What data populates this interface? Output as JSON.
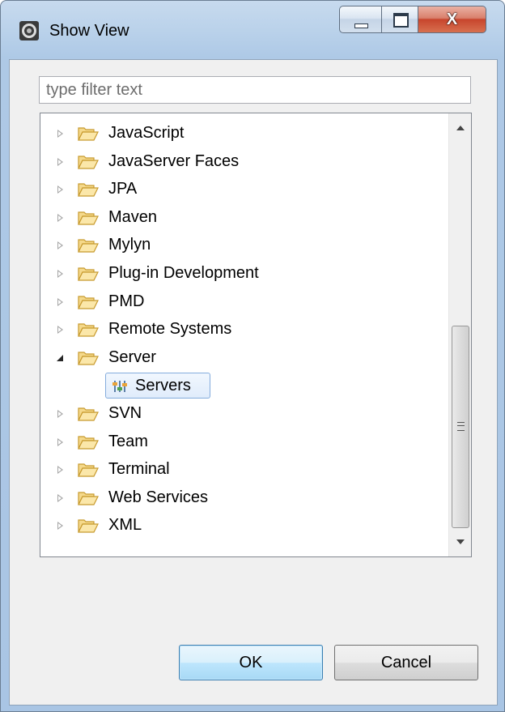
{
  "window": {
    "title": "Show View",
    "icon": "eclipse-icon",
    "close_glyph": "X"
  },
  "filter": {
    "placeholder": "type filter text",
    "value": ""
  },
  "tree": {
    "items": [
      {
        "label": "JavaScript",
        "expanded": false
      },
      {
        "label": "JavaServer Faces",
        "expanded": false
      },
      {
        "label": "JPA",
        "expanded": false
      },
      {
        "label": "Maven",
        "expanded": false
      },
      {
        "label": "Mylyn",
        "expanded": false
      },
      {
        "label": "Plug-in Development",
        "expanded": false
      },
      {
        "label": "PMD",
        "expanded": false
      },
      {
        "label": "Remote Systems",
        "expanded": false
      },
      {
        "label": "Server",
        "expanded": true,
        "children": [
          {
            "label": "Servers",
            "icon": "servers-icon",
            "selected": true
          }
        ]
      },
      {
        "label": "SVN",
        "expanded": false
      },
      {
        "label": "Team",
        "expanded": false
      },
      {
        "label": "Terminal",
        "expanded": false
      },
      {
        "label": "Web Services",
        "expanded": false
      },
      {
        "label": "XML",
        "expanded": false
      }
    ]
  },
  "buttons": {
    "ok": "OK",
    "cancel": "Cancel"
  },
  "colors": {
    "selection_border": "#84acdd",
    "folder_fill": "#f5d98b",
    "folder_stroke": "#c79a2e"
  }
}
